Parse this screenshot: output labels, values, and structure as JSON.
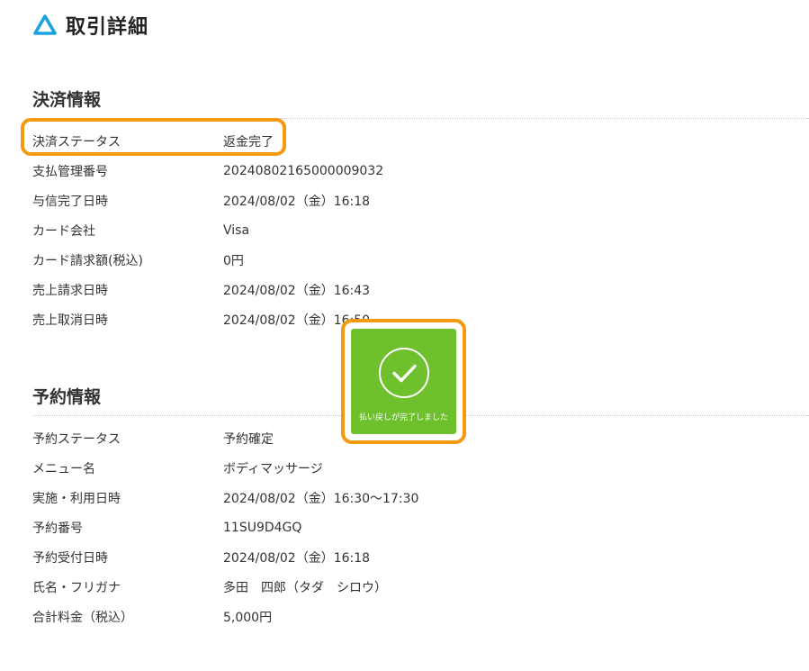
{
  "header": {
    "logo_icon": "triangle-logo-icon",
    "title": "取引詳細",
    "accent_color": "#1aa3e0"
  },
  "payment": {
    "title": "決済情報",
    "rows": [
      {
        "label": "決済ステータス",
        "value": "返金完了"
      },
      {
        "label": "支払管理番号",
        "value": "20240802165000009032"
      },
      {
        "label": "与信完了日時",
        "value": "2024/08/02（金）16:18"
      },
      {
        "label": "カード会社",
        "value": "Visa"
      },
      {
        "label": "カード請求額(税込)",
        "value": "0円"
      },
      {
        "label": "売上請求日時",
        "value": "2024/08/02（金）16:43"
      },
      {
        "label": "売上取消日時",
        "value": "2024/08/02（金）16:50"
      }
    ]
  },
  "reservation": {
    "title": "予約情報",
    "rows": [
      {
        "label": "予約ステータス",
        "value": "予約確定"
      },
      {
        "label": "メニュー名",
        "value": "ボディマッサージ"
      },
      {
        "label": "実施・利用日時",
        "value": "2024/08/02（金）16:30〜17:30"
      },
      {
        "label": "予約番号",
        "value": "11SU9D4GQ"
      },
      {
        "label": "予約受付日時",
        "value": "2024/08/02（金）16:18"
      },
      {
        "label": "氏名・フリガナ",
        "value": "多田　四郎（タダ　シロウ）"
      },
      {
        "label": "合計料金（税込）",
        "value": "5,000円"
      }
    ]
  },
  "toast": {
    "icon": "check-circle-icon",
    "message": "払い戻しが完了しました",
    "color": "#6ec02d"
  },
  "highlight_color": "#f39a0f"
}
